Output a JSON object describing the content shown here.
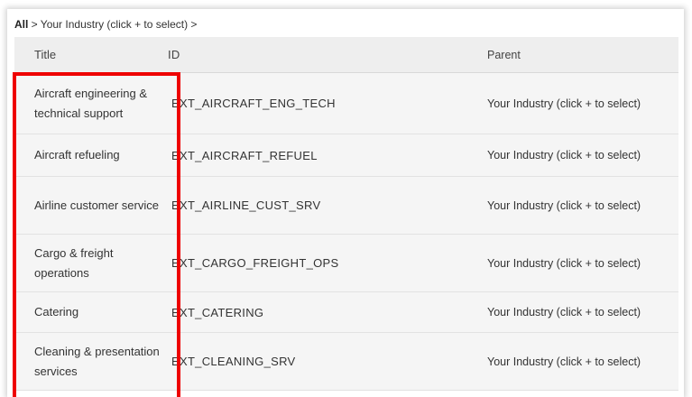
{
  "breadcrumb": {
    "root": "All",
    "rest": " > Your Industry (click + to select) >"
  },
  "table": {
    "columns": [
      "Title",
      "ID",
      "Parent"
    ],
    "rows": [
      {
        "title": "Aircraft engineering & technical support",
        "id": "EXT_AIRCRAFT_ENG_TECH",
        "parent": "Your Industry (click + to select)"
      },
      {
        "title": "Aircraft refueling",
        "id": "EXT_AIRCRAFT_REFUEL",
        "parent": "Your Industry (click + to select)"
      },
      {
        "title": "Airline customer service",
        "id": "EXT_AIRLINE_CUST_SRV",
        "parent": "Your Industry (click + to select)"
      },
      {
        "title": "Cargo & freight operations",
        "id": "EXT_CARGO_FREIGHT_OPS",
        "parent": "Your Industry (click + to select)"
      },
      {
        "title": "Catering",
        "id": "EXT_CATERING",
        "parent": "Your Industry (click + to select)"
      },
      {
        "title": "Cleaning & presentation services",
        "id": "EXT_CLEANING_SRV",
        "parent": "Your Industry (click + to select)"
      }
    ]
  },
  "highlight_color": "#ee0000"
}
